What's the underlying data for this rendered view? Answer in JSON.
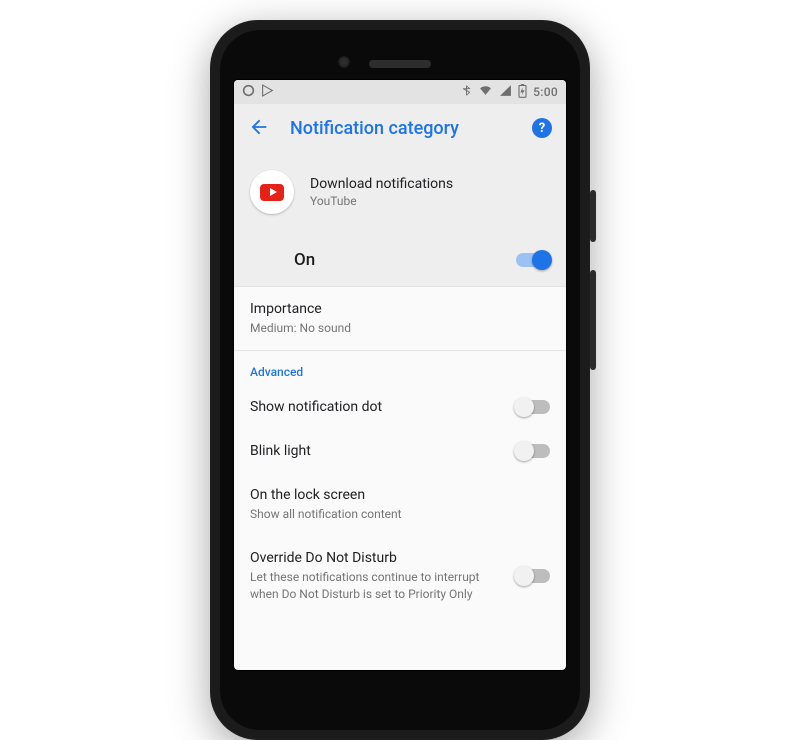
{
  "status_bar": {
    "time": "5:00"
  },
  "app_bar": {
    "title": "Notification category"
  },
  "channel": {
    "title": "Download notifications",
    "app_name": "YouTube"
  },
  "master": {
    "label": "On",
    "enabled": true
  },
  "importance": {
    "label": "Importance",
    "value": "Medium: No sound"
  },
  "section_advanced": "Advanced",
  "rows": {
    "show_dot": {
      "label": "Show notification dot",
      "enabled": false
    },
    "blink": {
      "label": "Blink light",
      "enabled": false
    },
    "lock": {
      "label": "On the lock screen",
      "value": "Show all notification content"
    },
    "dnd": {
      "label": "Override Do Not Disturb",
      "subtitle": "Let these notifications continue to interrupt when Do Not Disturb is set to Priority Only",
      "enabled": false
    }
  }
}
